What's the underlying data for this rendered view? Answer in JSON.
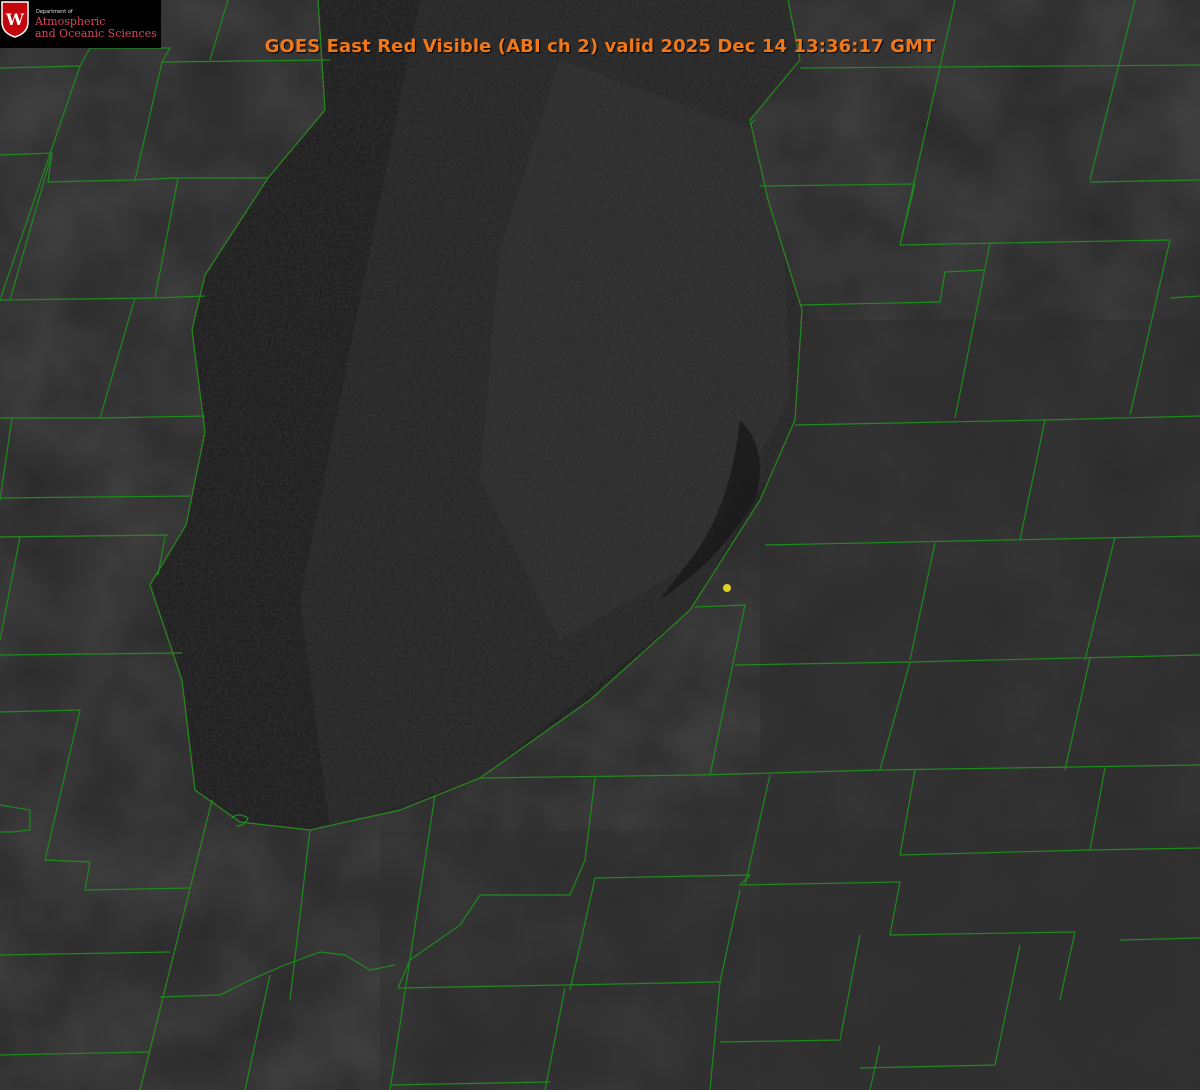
{
  "title": "GOES East Red Visible (ABI ch 2) valid 2025 Dec 14 13:36:17 GMT",
  "logo": {
    "crest_letter": "W",
    "line0": "Department of",
    "line1": "Atmospheric",
    "line2": "and Oceanic Sciences"
  },
  "colors": {
    "land": "#262626",
    "lake": "#1b1b1b",
    "county_lines": "#1f8a1f",
    "state_lines": "#c4382c",
    "title": "#f07818",
    "logo_text": "#d9475c",
    "marker": "#e0d020"
  },
  "icons": {
    "logo_crest": "uw-crest-icon",
    "station_marker": "yellow-dot-marker"
  }
}
